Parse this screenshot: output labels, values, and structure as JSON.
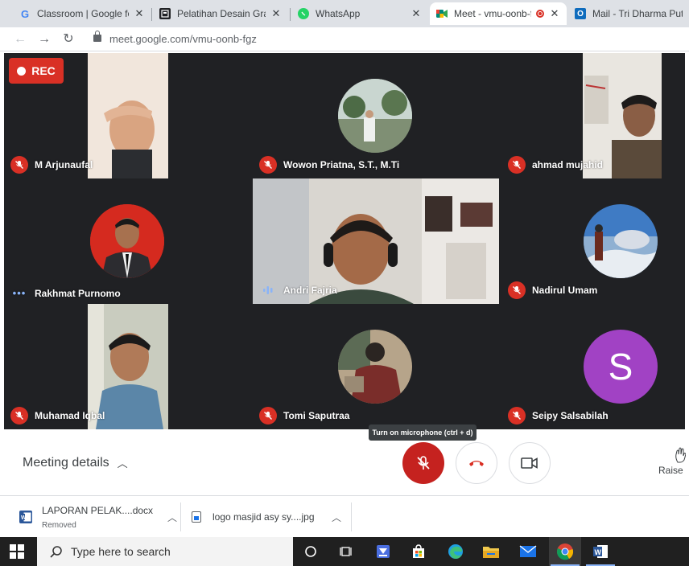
{
  "browser": {
    "tabs": [
      {
        "title": "Classroom | Google for",
        "favicon": "G",
        "favicon_color": "#4285f4"
      },
      {
        "title": "Pelatihan Desain Grafis",
        "favicon": "",
        "favicon_color": "#202124"
      },
      {
        "title": "WhatsApp",
        "favicon": "",
        "favicon_color": "#25d366"
      },
      {
        "title": "Meet - vmu-oonb-f",
        "favicon": "",
        "favicon_color": "#00897b"
      },
      {
        "title": "Mail - Tri Dharma Putra",
        "favicon": "O",
        "favicon_color": "#0f6cbd"
      }
    ],
    "url": "meet.google.com/vmu-oonb-fgz"
  },
  "meet": {
    "rec_label": "REC",
    "participants": [
      {
        "name": "M Arjunaufal",
        "status": "muted"
      },
      {
        "name": "Wowon Priatna, S.T., M.Ti",
        "status": "muted"
      },
      {
        "name": "ahmad mujahid",
        "status": "muted"
      },
      {
        "name": "Rakhmat Purnomo",
        "status": "dots"
      },
      {
        "name": "Andri Fajria",
        "status": "speaking"
      },
      {
        "name": "Nadirul Umam",
        "status": "muted"
      },
      {
        "name": "Muhamad Iqbal",
        "status": "muted"
      },
      {
        "name": "Tomi Saputraa",
        "status": "muted"
      },
      {
        "name": "Seipy Salsabilah",
        "status": "muted",
        "initial": "S",
        "avatar_color": "#a142c4"
      }
    ],
    "controls": {
      "meeting_details": "Meeting details",
      "tooltip": "Turn on microphone (ctrl + d)",
      "raise": "Raise"
    }
  },
  "downloads": [
    {
      "name": "LAPORAN PELAK....docx",
      "status": "Removed"
    },
    {
      "name": "logo masjid asy sy....jpg",
      "status": ""
    }
  ],
  "taskbar": {
    "search_placeholder": "Type here to search"
  },
  "colors": {
    "meet_bg": "#202124",
    "mute_red": "#d93025",
    "accent_blue": "#8ab4f8"
  }
}
